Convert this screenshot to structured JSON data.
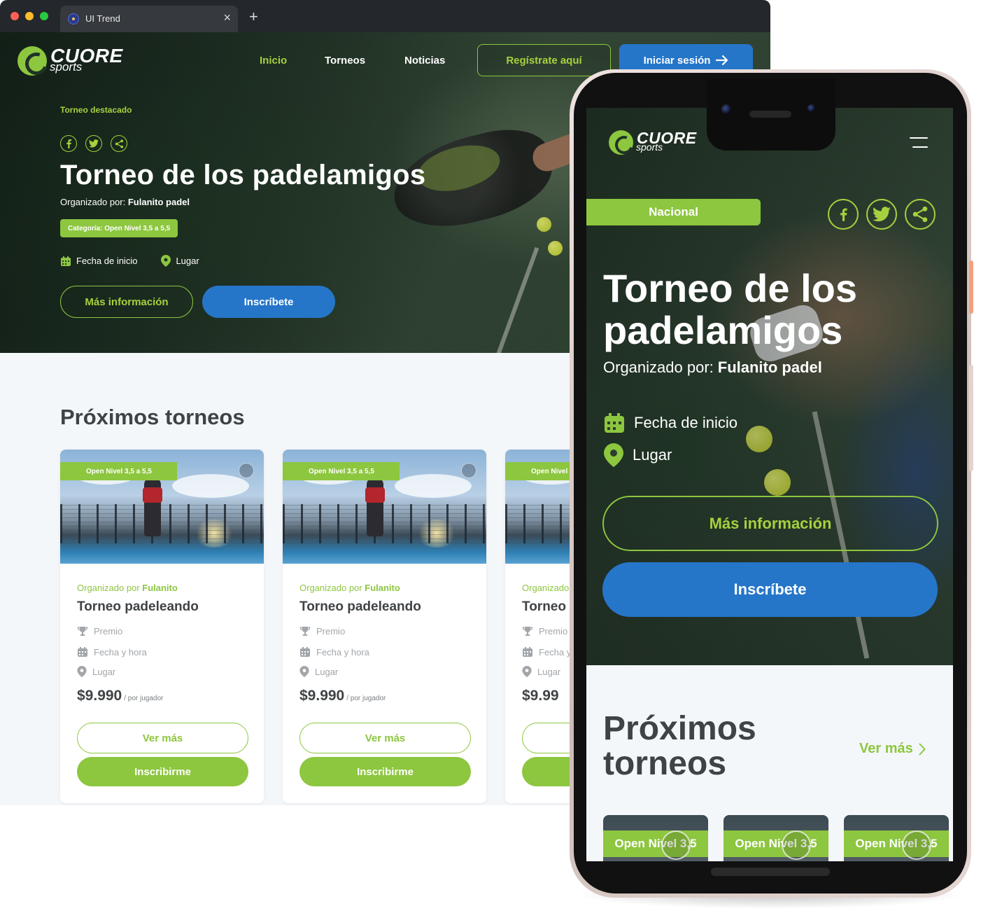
{
  "browser": {
    "tab_title": "UI Trend",
    "tab_close": "×",
    "new_tab": "+"
  },
  "brand": {
    "name": "CUORE",
    "tagline": "sports",
    "accent": "#8dc63f",
    "blue": "#2576c9"
  },
  "nav": {
    "items": [
      {
        "label": "Inicio",
        "active": true
      },
      {
        "label": "Torneos",
        "active": false
      },
      {
        "label": "Noticias",
        "active": false
      }
    ],
    "register": "Regístrate aquí",
    "login": "Iniciar sesión"
  },
  "hero": {
    "featured_label": "Torneo destacado",
    "title": "Torneo de los padelamigos",
    "organizer_prefix": "Organizado por:",
    "organizer_name": "Fulanito padel",
    "category_prefix": "Categoría:",
    "category_value": "Open Nivel 3,5 a 5,5",
    "start_date": "Fecha de inicio",
    "place": "Lugar",
    "more_info": "Más información",
    "signup": "Inscríbete"
  },
  "upcoming": {
    "title": "Próximos torneos",
    "cards": [
      {
        "badge": "Open Nivel 3,5 a 5,5",
        "org_prefix": "Organizado por",
        "org_name": "Fulanito",
        "title": "Torneo padeleando",
        "prize": "Premio",
        "datetime": "Fecha y hora",
        "place": "Lugar",
        "price": "$9.990",
        "per": "/ por jugador",
        "more": "Ver más",
        "go": "Inscribirme"
      },
      {
        "badge": "Open Nivel 3,5 a 5,5",
        "org_prefix": "Organizado por",
        "org_name": "Fulanito",
        "title": "Torneo padeleando",
        "prize": "Premio",
        "datetime": "Fecha y hora",
        "place": "Lugar",
        "price": "$9.990",
        "per": "/ por jugador",
        "more": "Ver más",
        "go": "Inscribirme"
      },
      {
        "badge": "Open Nivel",
        "org_prefix": "Organizado",
        "org_name": "",
        "title": "Torneo",
        "prize": "Premio",
        "datetime": "Fecha y",
        "place": "Lugar",
        "price": "$9.99",
        "per": "",
        "more": "",
        "go": ""
      }
    ]
  },
  "mobile": {
    "tag": "Nacional",
    "title": "Torneo de los padelamigos",
    "organizer_prefix": "Organizado por:",
    "organizer_name": "Fulanito padel",
    "start_date": "Fecha de inicio",
    "place": "Lugar",
    "more_info": "Más información",
    "signup": "Inscríbete",
    "section_title": "Próximos torneos",
    "see_more": "Ver más",
    "cards": [
      {
        "badge": "Open Nivel 3,5"
      },
      {
        "badge": "Open Nivel 3,5"
      },
      {
        "badge": "Open Nivel 3,5"
      }
    ]
  }
}
